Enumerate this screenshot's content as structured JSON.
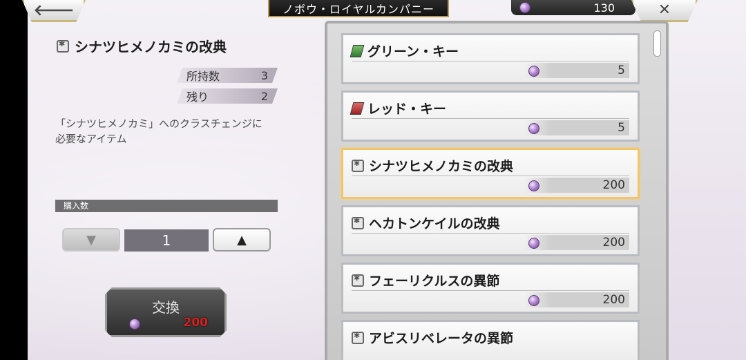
{
  "header": {
    "back_icon": "left-arrow-icon",
    "title": "ノボウ・ロイヤルカンパニー",
    "currency_value": "130",
    "close_icon": "close-x-icon"
  },
  "detail": {
    "title": "シナツヒメノカミの改典",
    "owned_label": "所持数",
    "owned_value": "3",
    "remaining_label": "残り",
    "remaining_value": "2",
    "description": "「シナツヒメノカミ」へのクラスチェンジに必要なアイテム",
    "quantity_label": "購入数",
    "quantity_value": "1",
    "decrease_icon": "down-triangle-icon",
    "increase_icon": "up-triangle-icon",
    "down_glyph": "▼",
    "up_glyph": "▲",
    "exchange_label": "交換",
    "exchange_cost": "200"
  },
  "shop_items": [
    {
      "name": "グリーン・キー",
      "price": "5",
      "icon": "green-key-icon"
    },
    {
      "name": "レッド・キー",
      "price": "5",
      "icon": "red-key-icon"
    },
    {
      "name": "シナツヒメノカミの改典",
      "price": "200",
      "icon": "book-icon",
      "selected": true
    },
    {
      "name": "ヘカトンケイルの改典",
      "price": "200",
      "icon": "book-icon"
    },
    {
      "name": "フェーリクルスの異節",
      "price": "200",
      "icon": "book-icon"
    },
    {
      "name": "アビスリベレータの異節",
      "price": "",
      "icon": "book-icon"
    }
  ],
  "colors": {
    "selected_border": "#f2c56a",
    "cost_red": "#d42020"
  }
}
